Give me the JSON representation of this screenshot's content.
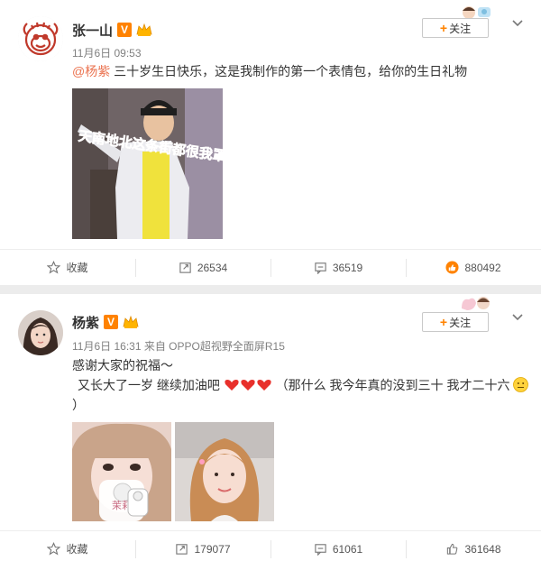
{
  "colors": {
    "accent": "#ff8200",
    "mention": "#eb7350",
    "meta": "#808080",
    "like_active": "#ff8200"
  },
  "posts": [
    {
      "author": "张一山",
      "time": "11月6日 09:53",
      "source": "",
      "follow_label": "关注",
      "mention": "@杨紫",
      "text": "三十岁生日快乐，这是我制作的第一个表情包，给你的生日礼物",
      "image_caption": "天南地北这条街都很我罩",
      "actions": {
        "favorite": "收藏",
        "repost": "26534",
        "comment": "36519",
        "like": "880492"
      }
    },
    {
      "author": "杨紫",
      "time": "11月6日 16:31",
      "source": "来自 OPPO超视野全面屏R15",
      "follow_label": "关注",
      "line1": "感谢大家的祝福～",
      "line2": "又长大了一岁 继续加油吧",
      "line2_tail": "（那什么 我今年真的没到三十 我才二十六",
      "line3": "）",
      "image_note": "茉莉",
      "actions": {
        "favorite": "收藏",
        "repost": "179077",
        "comment": "61061",
        "like": "361648"
      }
    }
  ]
}
